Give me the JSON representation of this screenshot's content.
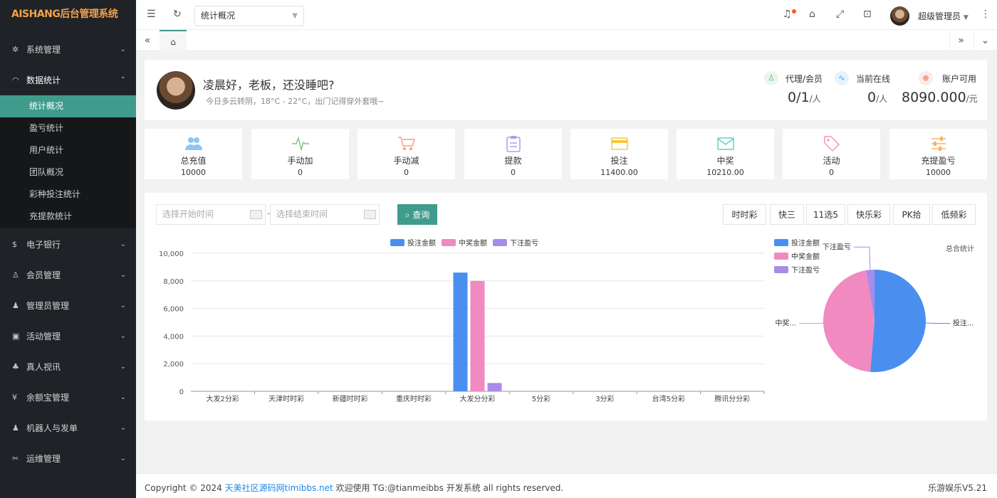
{
  "brand": "AISHANG后台管理系统",
  "sidebar": {
    "items": [
      {
        "label": "系统管理",
        "icon": "gear-icon"
      },
      {
        "label": "数据统计",
        "icon": "dashboard-icon"
      },
      {
        "label": "电子银行",
        "icon": "dollar-icon"
      },
      {
        "label": "会员管理",
        "icon": "users-icon"
      },
      {
        "label": "管理员管理",
        "icon": "user-icon"
      },
      {
        "label": "活动管理",
        "icon": "gift-icon"
      },
      {
        "label": "真人视讯",
        "icon": "group-icon"
      },
      {
        "label": "余额宝管理",
        "icon": "yen-icon"
      },
      {
        "label": "机器人与发单",
        "icon": "robot-icon"
      },
      {
        "label": "运维管理",
        "icon": "tools-icon"
      }
    ],
    "sub": [
      "统计概况",
      "盈亏统计",
      "用户统计",
      "团队概况",
      "彩种投注统计",
      "充提款统计"
    ]
  },
  "header": {
    "page_select": "统计概况",
    "admin_name": "超级管理员"
  },
  "welcome": {
    "greeting": "凌晨好，老板，还没睡吧?",
    "weather": "今日多云转阴，18°C - 22°C，出门记得穿外套哦~"
  },
  "kpis": [
    {
      "label": "代理/会员",
      "value": "0/1",
      "unit": "/人",
      "color": "#5fb878"
    },
    {
      "label": "当前在线",
      "value": "0",
      "unit": "/人",
      "color": "#1e9fff"
    },
    {
      "label": "账户可用",
      "value": "8090.000",
      "unit": "/元",
      "color": "#ff5722"
    }
  ],
  "stats": [
    {
      "label": "总充值",
      "value": "10000",
      "icon": "users-icon",
      "color": "#1e9fff"
    },
    {
      "label": "手动加",
      "value": "0",
      "icon": "pulse-icon",
      "color": "#5fb878"
    },
    {
      "label": "手动减",
      "value": "0",
      "icon": "cart-icon",
      "color": "#ff7f50"
    },
    {
      "label": "提款",
      "value": "0",
      "icon": "clipboard-icon",
      "color": "#8e44ad"
    },
    {
      "label": "投注",
      "value": "11400.00",
      "icon": "card-icon",
      "color": "#f0b400"
    },
    {
      "label": "中奖",
      "value": "10210.00",
      "icon": "mail-icon",
      "color": "#2ec4b6"
    },
    {
      "label": "活动",
      "value": "0",
      "icon": "tag-icon",
      "color": "#ff6a88"
    },
    {
      "label": "充提盈亏",
      "value": "10000",
      "icon": "sliders-icon",
      "color": "#f0a24a"
    }
  ],
  "filters": {
    "start_placeholder": "选择开始时间",
    "end_placeholder": "选择结束时间",
    "query_label": "查询",
    "lottery_buttons": [
      "时时彩",
      "快三",
      "11选5",
      "快乐彩",
      "PK拾",
      "低频彩"
    ]
  },
  "chart_data": [
    {
      "type": "bar",
      "categories": [
        "大发2分彩",
        "天津时时彩",
        "新疆时时彩",
        "重庆时时彩",
        "大发分分彩",
        "5分彩",
        "3分彩",
        "台湾5分彩",
        "腾讯分分彩"
      ],
      "series": [
        {
          "name": "投注金额",
          "color": "#4a8ff0",
          "values": [
            0,
            0,
            0,
            0,
            8600,
            0,
            0,
            0,
            0
          ]
        },
        {
          "name": "中奖金额",
          "color": "#f08ac0",
          "values": [
            0,
            0,
            0,
            0,
            8000,
            0,
            0,
            0,
            0
          ]
        },
        {
          "name": "下注盈亏",
          "color": "#a98ce8",
          "values": [
            0,
            0,
            0,
            0,
            600,
            0,
            0,
            0,
            0
          ]
        }
      ],
      "ylim": [
        0,
        10000
      ],
      "yticks": [
        "10,000",
        "8,000",
        "6,000",
        "4,000",
        "2,000",
        "0"
      ],
      "legend": "top-center",
      "grid": true
    },
    {
      "type": "pie",
      "title": "总合统计",
      "labels": [
        "投注...",
        "中奖...",
        "下注盈亏"
      ],
      "legend_labels": [
        "投注金额",
        "中奖金额",
        "下注盈亏"
      ],
      "values": [
        11400,
        10210,
        600
      ],
      "colors": [
        "#4a8ff0",
        "#f08ac0",
        "#a98ce8"
      ],
      "legend": "top-left"
    }
  ],
  "footer": {
    "copyright": "Copyright © 2024",
    "link": "天美社区源码网timibbs.net",
    "rest": "欢迎使用 TG:@tianmeibbs 开发系统 all rights reserved.",
    "version": "乐游娱乐V5.21"
  }
}
